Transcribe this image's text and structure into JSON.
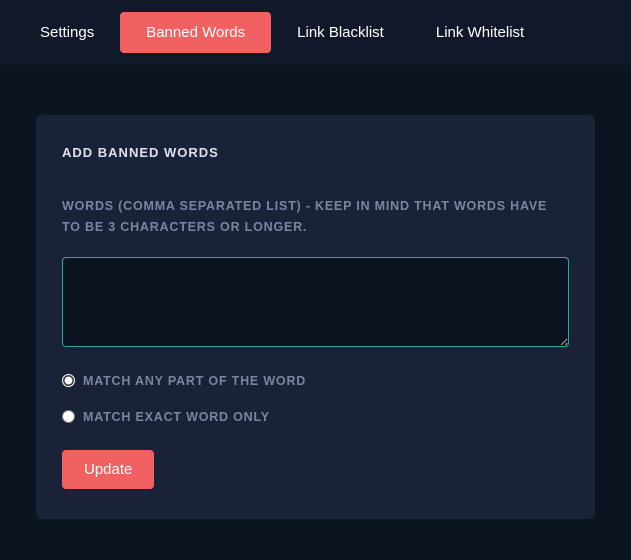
{
  "tabs": {
    "settings": "Settings",
    "banned_words": "Banned Words",
    "link_blacklist": "Link Blacklist",
    "link_whitelist": "Link Whitelist",
    "active": "banned_words"
  },
  "panel": {
    "title": "ADD BANNED WORDS",
    "field_label": "WORDS (COMMA SEPARATED LIST) - KEEP IN MIND THAT WORDS HAVE TO BE 3 CHARACTERS OR LONGER.",
    "textarea_value": "",
    "match_options": {
      "any_part": "MATCH ANY PART OF THE WORD",
      "exact": "MATCH EXACT WORD ONLY",
      "selected": "any_part"
    },
    "update_button": "Update"
  }
}
